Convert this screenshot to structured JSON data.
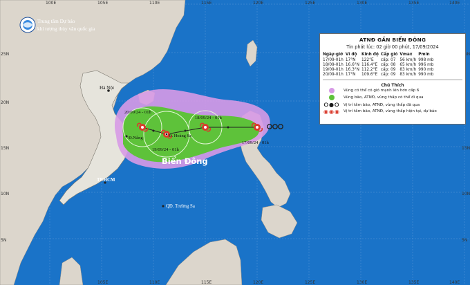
{
  "map": {
    "longitude_ticks": [
      "100E",
      "105E",
      "110E",
      "115E",
      "120E",
      "125E",
      "130E",
      "135E",
      "140E",
      "145E"
    ],
    "latitude_ticks": [
      "30N",
      "25N",
      "20N",
      "15N",
      "10N",
      "5N"
    ],
    "places": {
      "ha_noi": "Hà Nội",
      "da_nang": "Đ.Nẵng",
      "hcm": "TP.HCM",
      "hoang_sa": "Đ. Hoàng Sa",
      "truong_sa": "QĐ. Trường Sa",
      "bien_dong": "Biển Đông"
    },
    "track_labels": {
      "p1": "17/09/24 - 01h",
      "p2": "18/09/24 - 01h",
      "p3": "19/09/24 - 01h",
      "p4": "20/09/24 - 01h"
    },
    "colors": {
      "sea": "#1a73c8",
      "land": "#dcd6cc",
      "vietnam": "#e6e4dc",
      "risk_zone": "#d79ae6",
      "strong_wind": "#5ec23a",
      "storm_symbol": "#d93a2c"
    }
  },
  "logo": {
    "line1": "Trung tâm Dự báo",
    "line2": "khí tượng thủy văn quốc gia"
  },
  "info_box": {
    "title": "ATNĐ GẦN BIỂN ĐÔNG",
    "issued": "Tin phát lúc: 02 giờ 00 phút, 17/09/2024",
    "headers": [
      "Ngày-giờ",
      "Vĩ độ",
      "Kinh độ",
      "Cấp gió",
      "Vmax",
      "Pmin"
    ],
    "rows": [
      [
        "17/09-01h",
        "17°N",
        "122°E",
        "cấp: 07",
        "56 km/h",
        "998 mb"
      ],
      [
        "18/09-01h",
        "16.6°N",
        "116.4°E",
        "cấp: 08",
        "65 km/h",
        "996 mb"
      ],
      [
        "19/09-01h",
        "16.3°N",
        "112.2°E",
        "cấp: 09",
        "83 km/h",
        "990 mb"
      ],
      [
        "20/09-01h",
        "17°N",
        "109.6°E",
        "cấp: 09",
        "83 km/h",
        "990 mb"
      ]
    ],
    "legend_title": "Chú Thích",
    "legend": [
      "Vùng có thể có gió mạnh lên hơn cấp 6",
      "Vùng bão, ATNĐ, vùng thấp có thể đi qua",
      "Vị trí tâm bão, ATNĐ, vùng thấp đã qua",
      "Vị trí tâm bão, ATNĐ, vùng thấp hiện tại, dự báo"
    ]
  }
}
